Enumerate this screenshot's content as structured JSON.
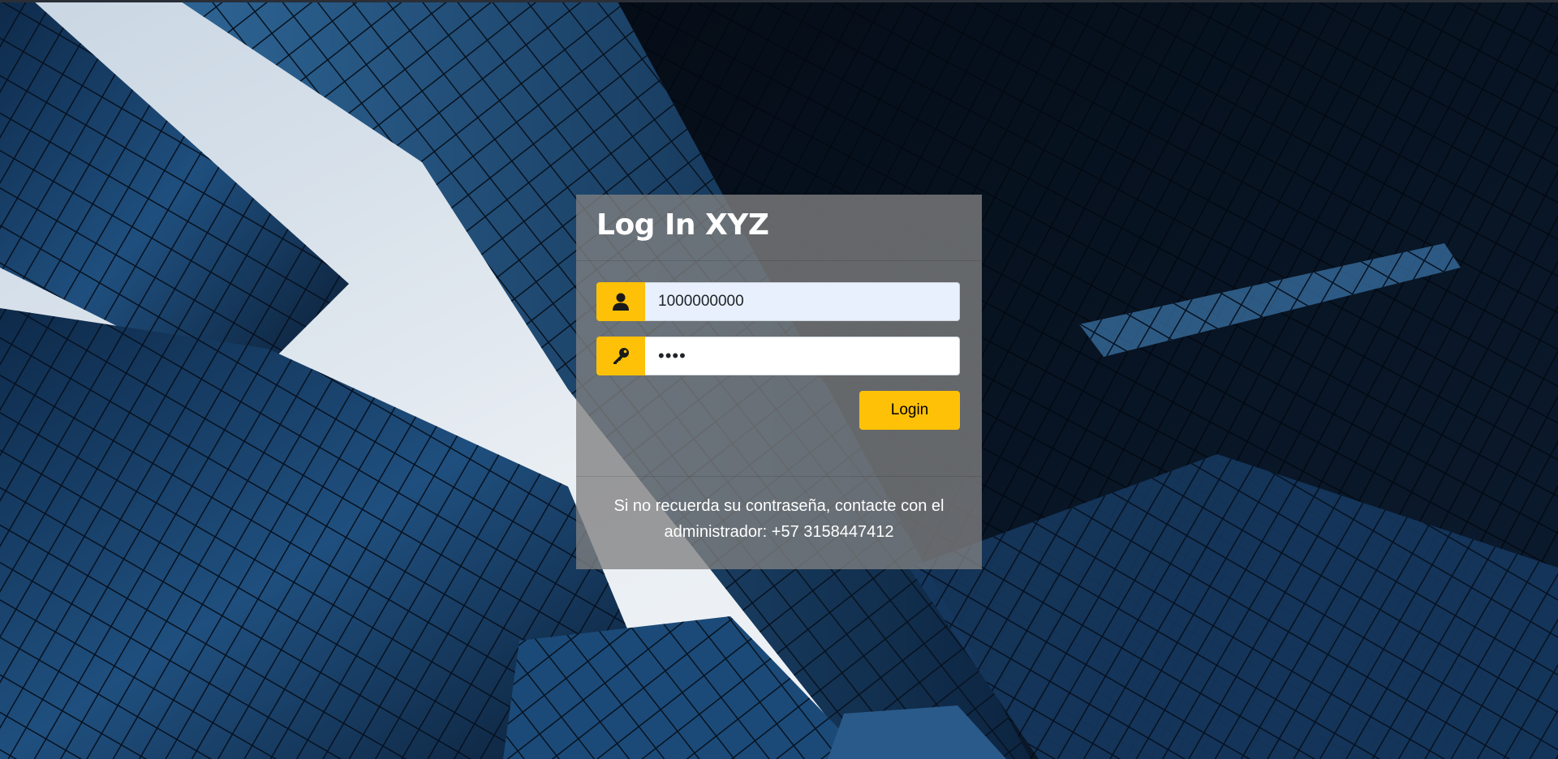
{
  "login": {
    "title": "Log In XYZ",
    "username": {
      "value": "1000000000",
      "icon": "user-icon"
    },
    "password": {
      "value": "••••",
      "icon": "key-icon"
    },
    "button_label": "Login",
    "footer_text": "Si no recuerda su contraseña, contacte con el administrador: +57 3158447412"
  },
  "colors": {
    "accent": "#ffc107",
    "card_bg": "rgba(128,128,128,0.78)",
    "input_autofill_bg": "#e8f0fe"
  },
  "background": {
    "description_icon": "glass-skyscrapers-background"
  }
}
